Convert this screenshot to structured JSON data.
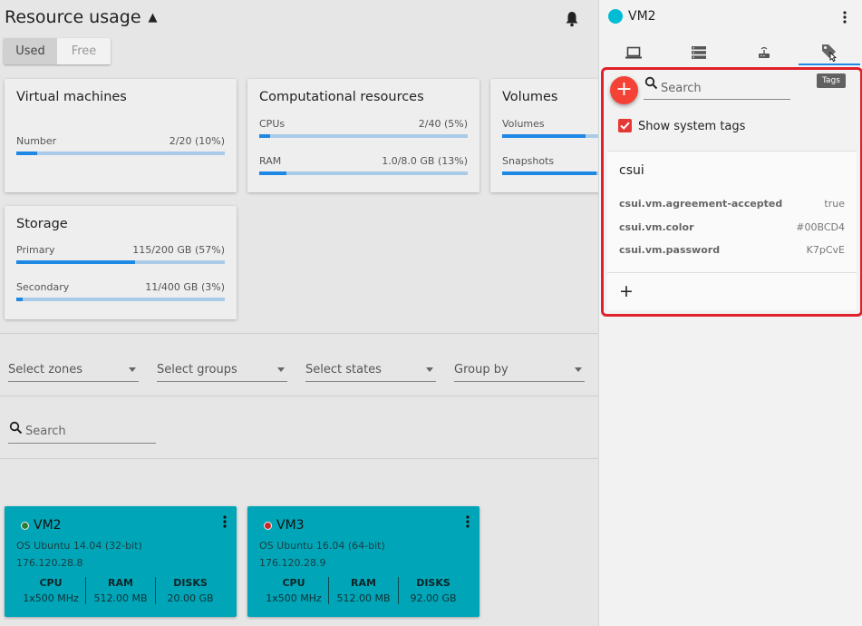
{
  "header": {
    "title": "Resource usage"
  },
  "toggle": {
    "used": "Used",
    "free": "Free"
  },
  "cards": {
    "vms": {
      "title": "Virtual machines",
      "metrics": [
        {
          "label": "Number",
          "value": "2/20 (10%)",
          "fraction": 0.1
        }
      ]
    },
    "compute": {
      "title": "Computational resources",
      "metrics": [
        {
          "label": "CPUs",
          "value": "2/40 (5%)",
          "fraction": 0.05
        },
        {
          "label": "RAM",
          "value": "1.0/8.0 GB (13%)",
          "fraction": 0.13
        }
      ]
    },
    "volumes": {
      "title": "Volumes",
      "metrics": [
        {
          "label": "Volumes",
          "value": "",
          "fraction": 0.4
        },
        {
          "label": "Snapshots",
          "value": "",
          "fraction": 0.45
        }
      ]
    },
    "storage": {
      "title": "Storage",
      "metrics": [
        {
          "label": "Primary",
          "value": "115/200 GB (57%)",
          "fraction": 0.57
        },
        {
          "label": "Secondary",
          "value": "11/400 GB (3%)",
          "fraction": 0.03
        }
      ]
    }
  },
  "filters": {
    "zones": "Select zones",
    "groups": "Select groups",
    "states": "Select states",
    "groupby": "Group by"
  },
  "search": {
    "placeholder": "Search"
  },
  "vms": [
    {
      "name": "VM2",
      "status_color": "#2e7d32",
      "os": "OS Ubuntu 14.04 (32-bit)",
      "ip": "176.120.28.8",
      "cpu_label": "CPU",
      "cpu": "1x500 MHz",
      "ram_label": "RAM",
      "ram": "512.00 MB",
      "disks_label": "DISKS",
      "disks": "20.00 GB"
    },
    {
      "name": "VM3",
      "status_color": "#c62828",
      "os": "OS Ubuntu 16.04 (64-bit)",
      "ip": "176.120.28.9",
      "cpu_label": "CPU",
      "cpu": "1x500 MHz",
      "ram_label": "RAM",
      "ram": "512.00 MB",
      "disks_label": "DISKS",
      "disks": "92.00 GB"
    }
  ],
  "sidebar": {
    "vm_name": "VM2",
    "vm_color": "#00bcd4",
    "tabs": [
      {
        "icon": "laptop-icon"
      },
      {
        "icon": "storage-icon"
      },
      {
        "icon": "router-icon"
      },
      {
        "icon": "tag-icon"
      }
    ],
    "tooltip": "Tags",
    "tags_search_placeholder": "Search",
    "show_system_tags": "Show system tags",
    "tag_group": "csui",
    "tags": [
      {
        "key": "csui.vm.agreement-accepted",
        "value": "true"
      },
      {
        "key": "csui.vm.color",
        "value": "#00BCD4"
      },
      {
        "key": "csui.vm.password",
        "value": "K7pCvE"
      }
    ],
    "add_symbol": "+"
  }
}
